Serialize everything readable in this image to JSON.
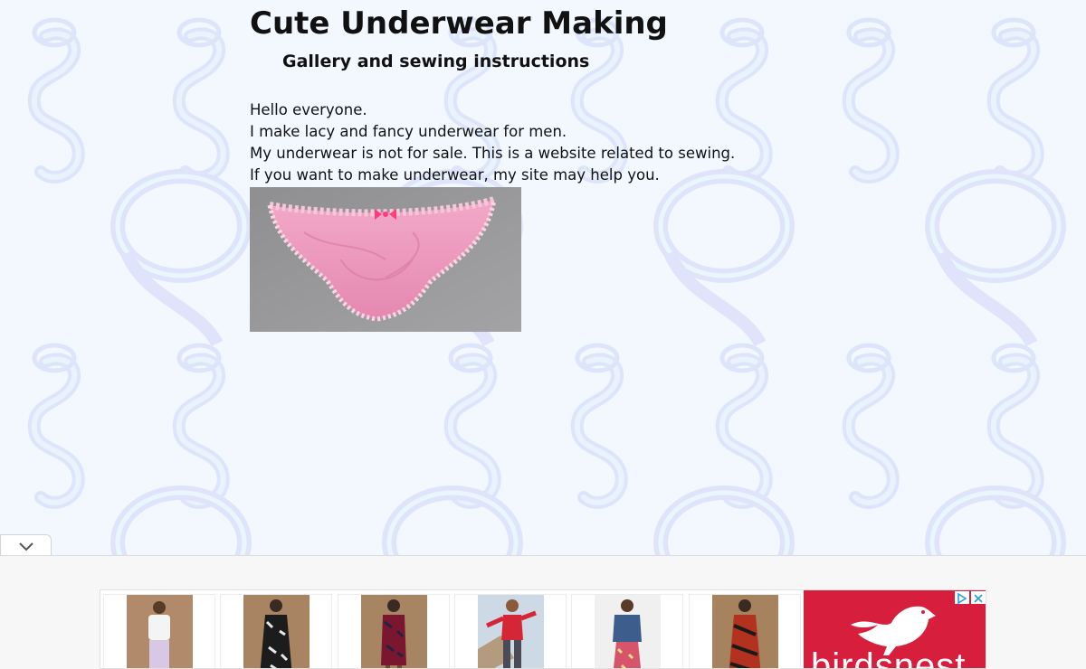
{
  "header": {
    "title": "Cute Underwear Making",
    "subtitle": "Gallery and sewing instructions"
  },
  "intro": {
    "lines": [
      "Hello everyone.",
      "I make lacy and fancy underwear for men.",
      "My underwear is not for sale. This is a website related to sewing.",
      "If you want to make underwear, my site may help you."
    ]
  },
  "ad": {
    "brand": "birdsnest",
    "colors": {
      "brand_bg": "#d81e3d",
      "page_bg": "#f3f8ff",
      "pattern": "#dfe6fb"
    },
    "products": [
      {
        "outfit": "white top, lilac pants",
        "colors": [
          "#b08a6a",
          "#f4f4f4",
          "#d9c7e6"
        ]
      },
      {
        "outfit": "black and white print dress",
        "colors": [
          "#a88462",
          "#1c1c1c",
          "#e8e8e8"
        ]
      },
      {
        "outfit": "red and navy print dress",
        "colors": [
          "#a78563",
          "#7b1630",
          "#1f2540"
        ]
      },
      {
        "outfit": "red knit, jeans",
        "colors": [
          "#cdd9e4",
          "#d42636",
          "#4b4b58"
        ]
      },
      {
        "outfit": "denim jacket, floral skirt",
        "colors": [
          "#f0f0f0",
          "#3d5d8c",
          "#d6556b"
        ]
      },
      {
        "outfit": "red and black print dress",
        "colors": [
          "#a6825e",
          "#b3321f",
          "#1a1a1a"
        ]
      }
    ]
  }
}
